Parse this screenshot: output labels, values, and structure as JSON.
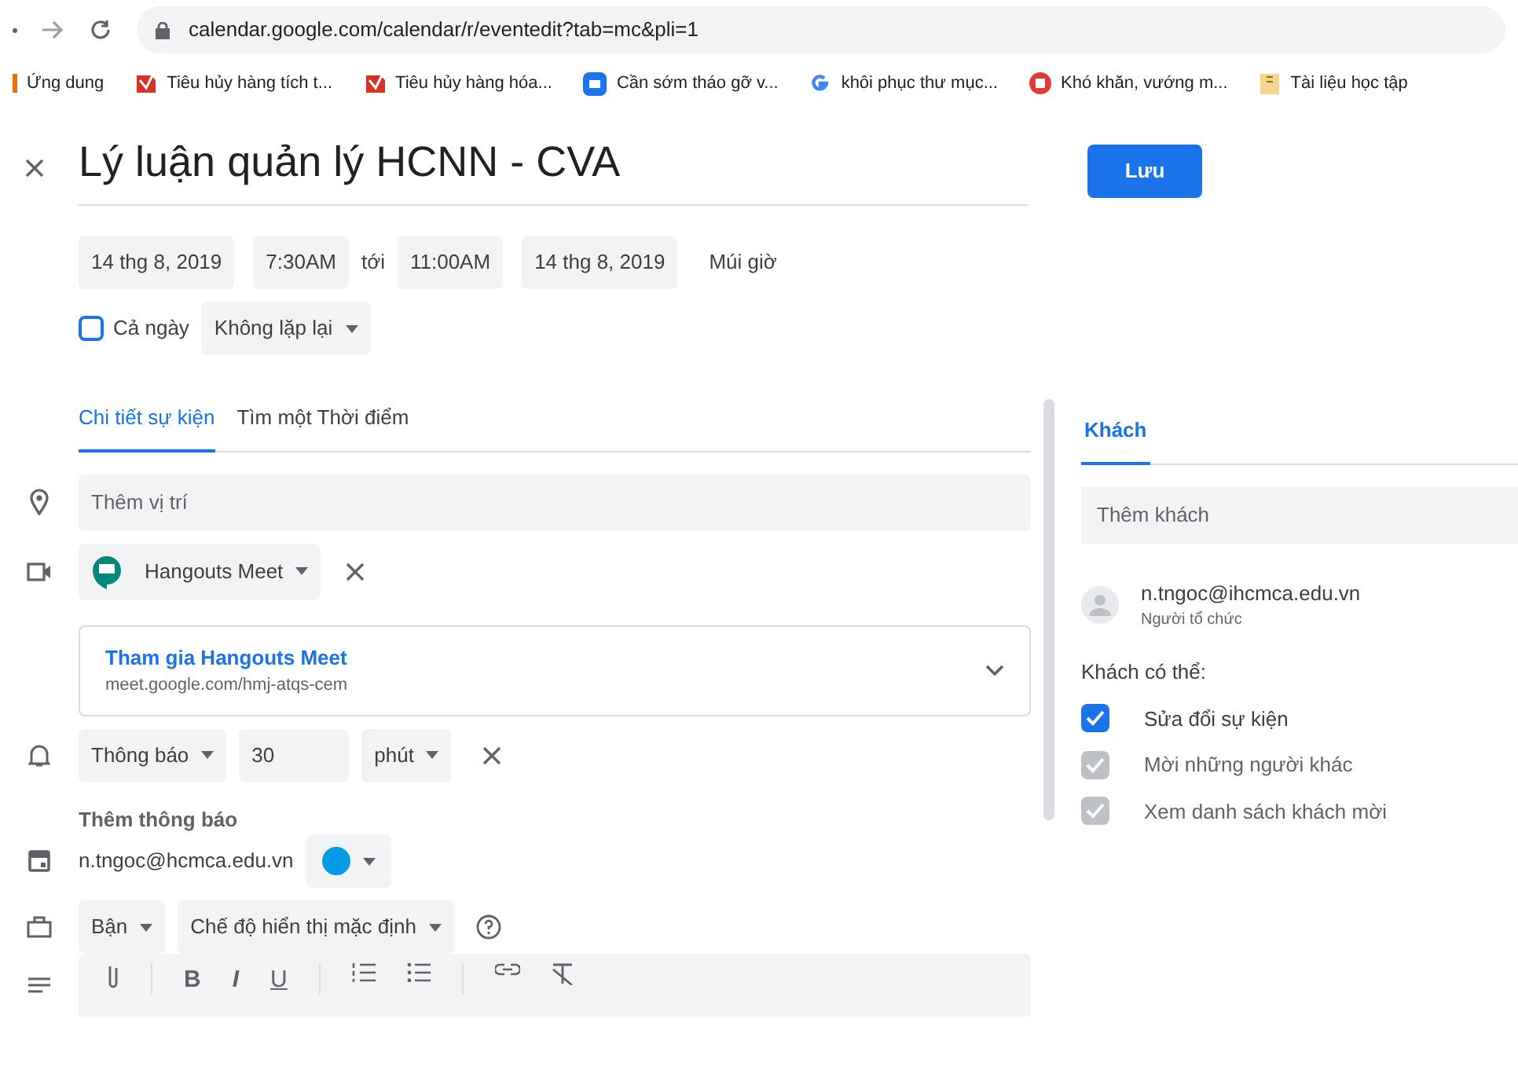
{
  "browser": {
    "url": "calendar.google.com/calendar/r/eventedit?tab=mc&pli=1"
  },
  "bookmarks": [
    {
      "label": "Ứng dung",
      "kind": "apps"
    },
    {
      "label": "Tiêu hủy hàng tích t...",
      "kind": "red"
    },
    {
      "label": "Tiêu hủy hàng hóa...",
      "kind": "red"
    },
    {
      "label": "Cần sớm tháo gỡ v...",
      "kind": "hg"
    },
    {
      "label": "khôi phục thư mục...",
      "kind": "g"
    },
    {
      "label": "Khó khăn, vướng m...",
      "kind": "redcircle"
    },
    {
      "label": "Tài liệu học tập",
      "kind": "folder"
    }
  ],
  "event": {
    "title": "Lý luận quản lý HCNN - CVA",
    "start_date": "14 thg 8, 2019",
    "start_time": "7:30AM",
    "to": "tới",
    "end_time": "11:00AM",
    "end_date": "14 thg 8, 2019",
    "timezone": "Múi giờ",
    "all_day": {
      "label": "Cả ngày",
      "checked": false
    },
    "repeat": "Không lặp lại"
  },
  "save_button": "Lưu",
  "tabs": [
    {
      "label": "Chi tiết sự kiện",
      "selected": true
    },
    {
      "label": "Tìm một Thời điểm",
      "selected": false
    }
  ],
  "location": {
    "placeholder": "Thêm vị trí"
  },
  "conference": {
    "name": "Hangouts Meet",
    "join": "Tham gia Hangouts Meet",
    "link": "meet.google.com/hmj-atqs-cem"
  },
  "notification": {
    "type": "Thông báo",
    "value": "30",
    "unit": "phút",
    "add": "Thêm thông báo"
  },
  "calendar": {
    "owner": "n.tngoc@hcmca.edu.vn",
    "color": "#039be5"
  },
  "availability": {
    "status": "Bận",
    "visibility": "Chế độ hiển thị mặc định"
  },
  "formatting": [
    "B",
    "I",
    "U"
  ],
  "guests_tab": {
    "label": "Khách",
    "selected": true
  },
  "guests": {
    "placeholder": "Thêm khách",
    "list": [
      {
        "email": "n.tngoc@ihcmca.edu.vn",
        "role": "Người tổ chức"
      }
    ],
    "permissions_title": "Khách có thể:",
    "permissions": [
      {
        "label": "Sửa đổi sự kiện",
        "checked": true,
        "disabled": false
      },
      {
        "label": "Mời những người khác",
        "checked": true,
        "disabled": true
      },
      {
        "label": "Xem danh sách khách mời",
        "checked": true,
        "disabled": true
      }
    ]
  }
}
